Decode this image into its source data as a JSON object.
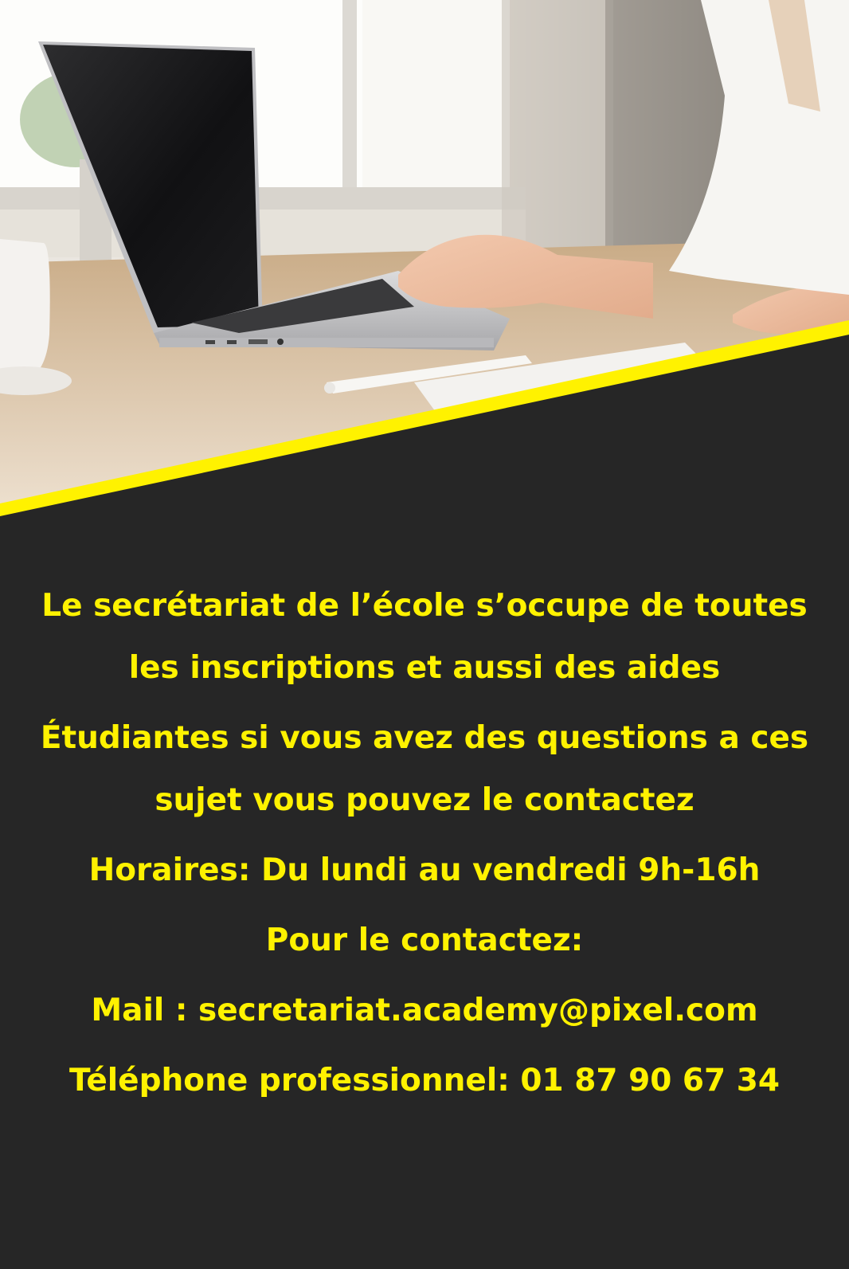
{
  "theme": {
    "background": "#262626",
    "accent": "#fff200"
  },
  "photo": {
    "subject": "laptop-on-desk-with-hands-typing"
  },
  "text": {
    "intro_line1": "Le secrétariat de l’école s’occupe de toutes",
    "intro_line2": "les inscriptions et aussi des aides",
    "intro_line3": "Étudiantes si vous avez des questions a ces",
    "intro_line4": "sujet vous pouvez le contactez",
    "hours": "Horaires: Du lundi au vendredi 9h-16h",
    "contact_heading": "Pour le contactez:",
    "mail": "Mail : secretariat.academy@pixel.com",
    "phone": "Téléphone professionnel: 01 87 90 67 34"
  }
}
